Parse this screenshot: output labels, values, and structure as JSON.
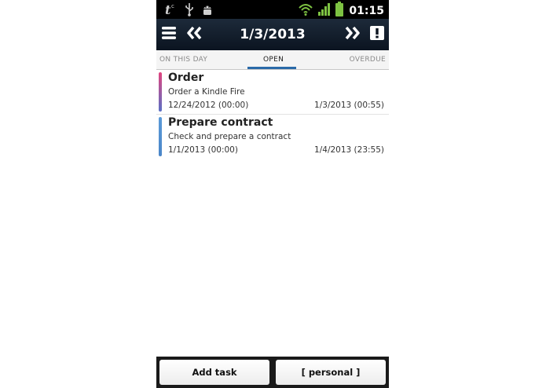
{
  "status_bar": {
    "time": "01:15",
    "icons": [
      "tasker-icon",
      "usb-icon",
      "android-debug-icon",
      "wifi-icon",
      "signal-icon",
      "battery-icon"
    ]
  },
  "action_bar": {
    "menu_icon": "menu-icon",
    "prev_icon": "double-chevron-left-icon",
    "title": "1/3/2013",
    "next_icon": "double-chevron-right-icon",
    "alert_icon": "exclamation-icon"
  },
  "tabs": [
    {
      "label": "ON THIS DAY",
      "active": false
    },
    {
      "label": "OPEN",
      "active": true
    },
    {
      "label": "OVERDUE",
      "active": false
    }
  ],
  "tasks": [
    {
      "title": "Order",
      "description": "Order a Kindle Fire",
      "start": "12/24/2012 (00:00)",
      "end": "1/3/2013 (00:55)",
      "color_top": "#e0457f",
      "color_bottom": "#5a6fc4"
    },
    {
      "title": "Prepare contract",
      "description": "Check and prepare a contract",
      "start": "1/1/2013 (00:00)",
      "end": "1/4/2013 (23:55)",
      "color_top": "#5b9ad8",
      "color_bottom": "#4a86c8"
    }
  ],
  "bottom_bar": {
    "add_task_label": "Add task",
    "category_label": "[ personal ]"
  }
}
